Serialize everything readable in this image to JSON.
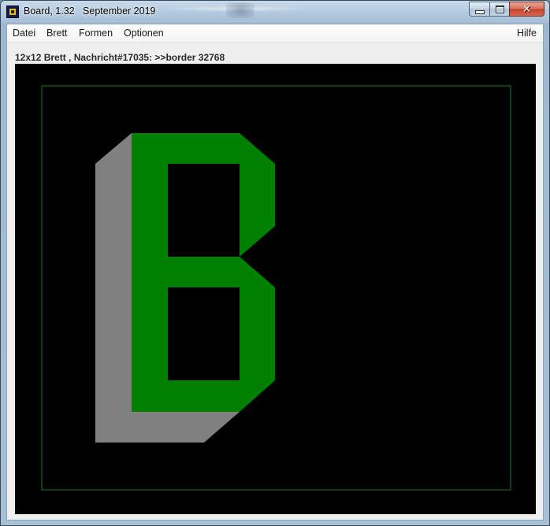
{
  "window": {
    "title": "Board, 1.32   September 2019",
    "controls": {
      "minimize": "minimize-icon",
      "maximize": "maximize-icon",
      "close": "close-icon"
    }
  },
  "menubar": {
    "items": [
      {
        "label": "Datei"
      },
      {
        "label": "Brett"
      },
      {
        "label": "Formen"
      },
      {
        "label": "Optionen"
      }
    ],
    "help": "Hilfe"
  },
  "status": {
    "message": "12x12 Brett , Nachricht#17035: >>border 32768"
  },
  "board": {
    "grid": "12x12",
    "background_color": "#000000",
    "border_color": "#1f7a1f",
    "glyph": "B",
    "glyph_color": "#008000",
    "shadow_color": "#808080"
  }
}
